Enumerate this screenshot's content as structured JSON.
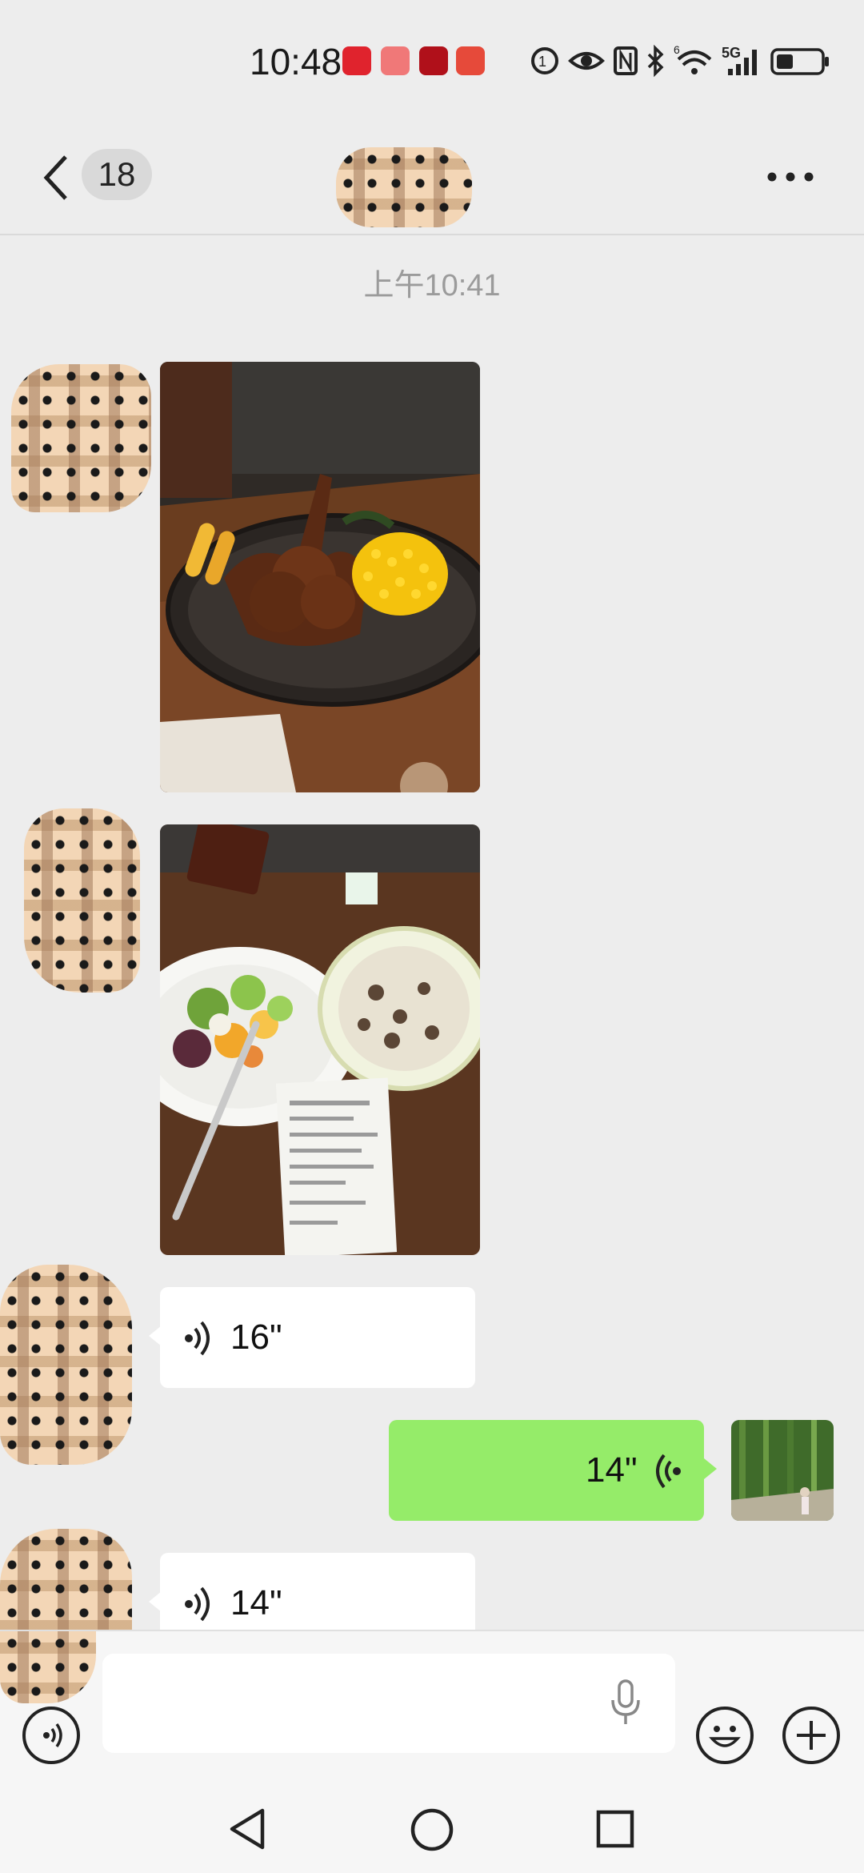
{
  "status_bar": {
    "time": "10:48",
    "app_icons": [
      "app-red-icon",
      "huawei-icon",
      "app-darkred-icon",
      "app-battery-red-icon"
    ],
    "indicators": [
      "nfc-icon",
      "eye-comfort-icon",
      "n-icon",
      "bluetooth-icon",
      "wifi-6-icon",
      "signal-5g-icon",
      "battery-icon"
    ],
    "network_label": "5G",
    "wifi_label": "6"
  },
  "header": {
    "unread_count": "18",
    "chat_title": ""
  },
  "chat": {
    "timestamp": "上午10:41",
    "messages": [
      {
        "type": "image",
        "direction": "incoming",
        "description": "steak-plate"
      },
      {
        "type": "image",
        "direction": "incoming",
        "description": "salad-and-risotto"
      },
      {
        "type": "voice",
        "direction": "incoming",
        "duration": "16\""
      },
      {
        "type": "voice",
        "direction": "outgoing",
        "duration": "14\""
      },
      {
        "type": "voice",
        "direction": "incoming",
        "duration": "14\""
      }
    ]
  },
  "input_bar": {
    "placeholder": ""
  },
  "colors": {
    "background": "#ededed",
    "outgoing_bubble": "#95ec69",
    "incoming_bubble": "#ffffff"
  }
}
